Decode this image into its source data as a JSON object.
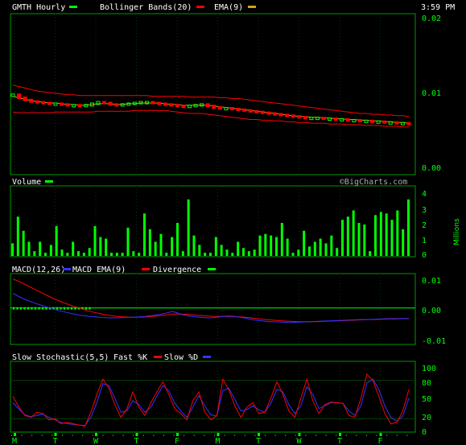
{
  "header": {
    "symbol": "GMTH Hourly",
    "bollinger_label": "Bollinger Bands(20)",
    "ema_label": "EMA(9)",
    "time": "3:59 PM",
    "watermark": "©BigCharts.com"
  },
  "colors": {
    "price_up": "#00ff00",
    "price_down": "#ff0000",
    "bollinger": "#ff0000",
    "ema": "#d4a017",
    "volume": "#00ff00",
    "macd": "#3333ff",
    "macd_ema": "#ff0000",
    "divergence": "#00ff00",
    "fast_k": "#ff0000",
    "slow_d": "#3333ff",
    "grid": "#006400",
    "text": "#00ff00"
  },
  "chart_data": [
    {
      "type": "line",
      "name": "price",
      "title": "GMTH Hourly",
      "legend": [
        "Bollinger Bands(20)",
        "EMA(9)"
      ],
      "y_ticks": [
        "0.02",
        "0.01",
        "0.00"
      ],
      "ylim": [
        0.0,
        0.02
      ],
      "price": [
        0.0097,
        0.0093,
        0.009,
        0.0088,
        0.0087,
        0.0086,
        0.0085,
        0.0085,
        0.0084,
        0.0083,
        0.0083,
        0.0082,
        0.0083,
        0.0085,
        0.0087,
        0.0086,
        0.0084,
        0.0083,
        0.0084,
        0.0085,
        0.0086,
        0.0087,
        0.0087,
        0.0086,
        0.0085,
        0.0084,
        0.0083,
        0.0082,
        0.0081,
        0.0082,
        0.0083,
        0.0084,
        0.0082,
        0.008,
        0.0079,
        0.0079,
        0.0078,
        0.0077,
        0.0076,
        0.0075,
        0.0074,
        0.0073,
        0.0072,
        0.0071,
        0.007,
        0.0069,
        0.0068,
        0.0067,
        0.0066,
        0.0066,
        0.0066,
        0.0065,
        0.0065,
        0.0064,
        0.0064,
        0.0063,
        0.0063,
        0.0062,
        0.0062,
        0.0061,
        0.0061,
        0.006,
        0.006,
        0.0059,
        0.0059,
        0.0058
      ],
      "ema": [
        0.0095,
        0.0093,
        0.0091,
        0.0089,
        0.0088,
        0.0087,
        0.0086,
        0.0086,
        0.0085,
        0.0084,
        0.0084,
        0.0083,
        0.0083,
        0.0084,
        0.0085,
        0.0085,
        0.0085,
        0.0084,
        0.0084,
        0.0085,
        0.0085,
        0.0086,
        0.0086,
        0.0086,
        0.0086,
        0.0085,
        0.0084,
        0.0084,
        0.0083,
        0.0083,
        0.0083,
        0.0083,
        0.0083,
        0.0082,
        0.0081,
        0.008,
        0.0079,
        0.0078,
        0.0077,
        0.0076,
        0.0075,
        0.0074,
        0.0073,
        0.0072,
        0.0071,
        0.007,
        0.0069,
        0.0068,
        0.0068,
        0.0067,
        0.0067,
        0.0066,
        0.0066,
        0.0065,
        0.0065,
        0.0064,
        0.0064,
        0.0063,
        0.0063,
        0.0062,
        0.0062,
        0.0061,
        0.0061,
        0.006,
        0.006,
        0.0059
      ],
      "bb_upper": [
        0.011,
        0.0108,
        0.0106,
        0.0104,
        0.0102,
        0.0101,
        0.01,
        0.0099,
        0.0098,
        0.0097,
        0.0097,
        0.0096,
        0.0096,
        0.0096,
        0.0096,
        0.0096,
        0.0096,
        0.0096,
        0.0096,
        0.0096,
        0.0096,
        0.0096,
        0.0096,
        0.0095,
        0.0095,
        0.0095,
        0.0095,
        0.0095,
        0.0095,
        0.0094,
        0.0094,
        0.0094,
        0.0094,
        0.0094,
        0.0093,
        0.0093,
        0.0092,
        0.0092,
        0.0091,
        0.009,
        0.0089,
        0.0088,
        0.0087,
        0.0086,
        0.0085,
        0.0084,
        0.0083,
        0.0082,
        0.0081,
        0.008,
        0.0079,
        0.0078,
        0.0077,
        0.0076,
        0.0075,
        0.0074,
        0.0073,
        0.0072,
        0.0072,
        0.0071,
        0.0071,
        0.007,
        0.007,
        0.0069,
        0.0069,
        0.0068
      ],
      "bb_lower": [
        0.0074,
        0.0073,
        0.0073,
        0.0073,
        0.0073,
        0.0073,
        0.0073,
        0.0074,
        0.0074,
        0.0074,
        0.0074,
        0.0074,
        0.0074,
        0.0074,
        0.0075,
        0.0075,
        0.0075,
        0.0075,
        0.0075,
        0.0075,
        0.0076,
        0.0076,
        0.0076,
        0.0076,
        0.0076,
        0.0076,
        0.0075,
        0.0074,
        0.0073,
        0.0072,
        0.0072,
        0.0072,
        0.0071,
        0.007,
        0.0069,
        0.0068,
        0.0067,
        0.0066,
        0.0065,
        0.0064,
        0.0064,
        0.0063,
        0.0063,
        0.0062,
        0.0062,
        0.0061,
        0.0061,
        0.006,
        0.006,
        0.0059,
        0.0059,
        0.0059,
        0.0058,
        0.0058,
        0.0058,
        0.0057,
        0.0057,
        0.0057,
        0.0056,
        0.0056,
        0.0056,
        0.0055,
        0.0055,
        0.0055,
        0.0054,
        0.0054
      ]
    },
    {
      "type": "bar",
      "name": "volume",
      "title": "Volume",
      "y_ticks": [
        "4",
        "3",
        "2",
        "1",
        "0"
      ],
      "ylabel": "Millions",
      "ylim": [
        0,
        4
      ],
      "values": [
        0.8,
        2.5,
        1.6,
        0.9,
        0.3,
        0.9,
        0.2,
        0.7,
        1.9,
        0.4,
        0.2,
        0.9,
        0.3,
        0.2,
        0.5,
        1.9,
        1.2,
        1.1,
        0.2,
        0.2,
        0.2,
        1.8,
        0.3,
        0.2,
        2.7,
        1.7,
        0.9,
        1.4,
        0.2,
        1.2,
        2.1,
        0.3,
        3.6,
        1.3,
        0.7,
        0.2,
        0.2,
        1.2,
        0.7,
        0.4,
        0.2,
        0.9,
        0.5,
        0.3,
        0.4,
        1.3,
        1.4,
        1.3,
        1.2,
        2.1,
        1.1,
        0.2,
        0.4,
        1.6,
        0.6,
        0.9,
        1.1,
        0.8,
        1.3,
        0.5,
        2.3,
        2.5,
        2.9,
        2.1,
        2.0,
        0.3,
        2.6,
        2.8,
        2.7,
        2.3,
        2.9,
        1.7,
        3.6
      ]
    },
    {
      "type": "line",
      "name": "macd",
      "title": "MACD(12,26)",
      "legend": [
        "MACD EMA(9)",
        "Divergence"
      ],
      "y_ticks": [
        "0.01",
        "0.00",
        "-0.01"
      ],
      "ylim": [
        -0.012,
        0.011
      ],
      "macd": [
        0.005,
        0.0038,
        0.0027,
        0.0018,
        0.001,
        0.0002,
        -0.0005,
        -0.0011,
        -0.0017,
        -0.0022,
        -0.0026,
        -0.0029,
        -0.0031,
        -0.0033,
        -0.0034,
        -0.0034,
        -0.0033,
        -0.0032,
        -0.0031,
        -0.0029,
        -0.0026,
        -0.0023,
        -0.0018,
        -0.0012,
        -0.002,
        -0.0026,
        -0.003,
        -0.0032,
        -0.0034,
        -0.0033,
        -0.003,
        -0.0028,
        -0.0029,
        -0.0033,
        -0.0038,
        -0.0042,
        -0.0045,
        -0.0047,
        -0.0048,
        -0.0049,
        -0.005,
        -0.0049,
        -0.0048,
        -0.0047,
        -0.0046,
        -0.0045,
        -0.0044,
        -0.0043,
        -0.0042,
        -0.0041,
        -0.004,
        -0.004,
        -0.0039,
        -0.0038,
        -0.0037,
        -0.0037,
        -0.0036,
        -0.0036
      ],
      "signal": [
        0.01,
        0.009,
        0.0078,
        0.0066,
        0.0054,
        0.0042,
        0.0031,
        0.0021,
        0.0012,
        0.0004,
        -0.0004,
        -0.0011,
        -0.0017,
        -0.0022,
        -0.0026,
        -0.0029,
        -0.0031,
        -0.0032,
        -0.0032,
        -0.0031,
        -0.0029,
        -0.0027,
        -0.0024,
        -0.0021,
        -0.0021,
        -0.0022,
        -0.0024,
        -0.0026,
        -0.0028,
        -0.0029,
        -0.0029,
        -0.0029,
        -0.003,
        -0.0031,
        -0.0033,
        -0.0036,
        -0.0039,
        -0.0041,
        -0.0043,
        -0.0045,
        -0.0046,
        -0.0047,
        -0.0047,
        -0.0047,
        -0.0047,
        -0.0046,
        -0.0045,
        -0.0044,
        -0.0043,
        -0.0042,
        -0.0041,
        -0.004,
        -0.004,
        -0.0039,
        -0.0038,
        -0.0038,
        -0.0037,
        -0.0037
      ]
    },
    {
      "type": "line",
      "name": "stochastic",
      "title": "Slow Stochastic(5,5)",
      "legend": [
        "Fast %K",
        "Slow %D"
      ],
      "y_ticks": [
        "100",
        "80",
        "50",
        "20",
        "0"
      ],
      "ylim": [
        0,
        100
      ],
      "fast_k": [
        55,
        38,
        25,
        22,
        30,
        28,
        18,
        20,
        12,
        14,
        12,
        10,
        8,
        30,
        58,
        82,
        68,
        42,
        22,
        35,
        62,
        38,
        25,
        45,
        62,
        78,
        58,
        35,
        28,
        18,
        48,
        62,
        30,
        18,
        25,
        82,
        65,
        40,
        22,
        38,
        45,
        28,
        30,
        52,
        78,
        58,
        32,
        22,
        52,
        82,
        48,
        28,
        42,
        46,
        45,
        44,
        25,
        22,
        52,
        90,
        80,
        55,
        28,
        12,
        14,
        32,
        66
      ],
      "slow_d": [
        45,
        35,
        26,
        23,
        25,
        27,
        22,
        18,
        14,
        12,
        11,
        10,
        9,
        22,
        45,
        75,
        72,
        52,
        30,
        32,
        48,
        42,
        30,
        38,
        55,
        72,
        64,
        44,
        32,
        22,
        38,
        56,
        40,
        26,
        24,
        64,
        68,
        50,
        32,
        34,
        40,
        34,
        30,
        44,
        66,
        62,
        42,
        28,
        40,
        70,
        58,
        36,
        40,
        45,
        45,
        44,
        32,
        25,
        40,
        76,
        82,
        66,
        40,
        22,
        16,
        24,
        52
      ],
      "x_ticks": [
        "M",
        "T",
        "W",
        "T",
        "F",
        "M",
        "T",
        "W",
        "T",
        "F"
      ]
    }
  ]
}
